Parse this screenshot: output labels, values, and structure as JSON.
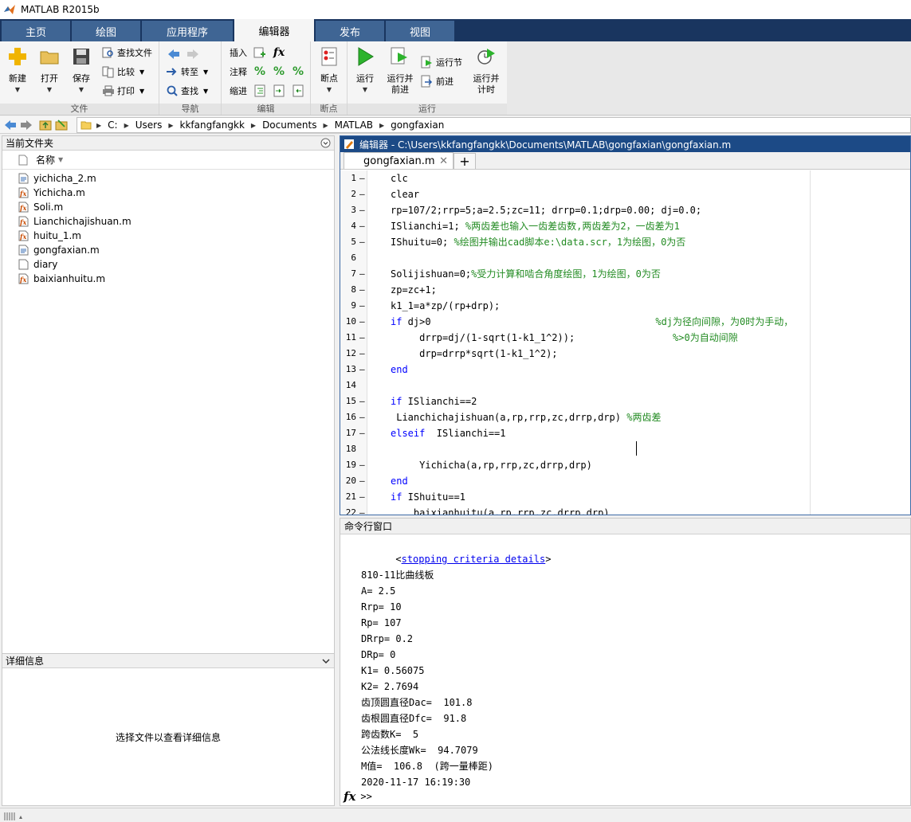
{
  "window": {
    "title": "MATLAB R2015b"
  },
  "tabs": [
    "主页",
    "绘图",
    "应用程序",
    "编辑器",
    "发布",
    "视图"
  ],
  "ribbon": {
    "file": {
      "new": "新建",
      "open": "打开",
      "save": "保存",
      "find_files": "查找文件",
      "compare": "比较",
      "print": "打印",
      "label": "文件"
    },
    "nav": {
      "goto": "转至",
      "find": "查找",
      "label": "导航"
    },
    "edit": {
      "insert": "插入",
      "comment": "注释",
      "indent": "缩进",
      "label": "编辑"
    },
    "breakpoints": {
      "btn": "断点",
      "label": "断点"
    },
    "run": {
      "run": "运行",
      "run_advance": "运行并\n前进",
      "run_section": "运行节",
      "advance": "前进",
      "run_time": "运行并\n计时",
      "label": "运行"
    }
  },
  "path": [
    "C:",
    "Users",
    "kkfangfangkk",
    "Documents",
    "MATLAB",
    "gongfaxian"
  ],
  "left_panel": {
    "title": "当前文件夹",
    "col_name": "名称",
    "files": [
      {
        "name": "yichicha_2.m",
        "icon": "mfile-icon"
      },
      {
        "name": "Yichicha.m",
        "icon": "function-file-icon"
      },
      {
        "name": "Soli.m",
        "icon": "function-file-icon"
      },
      {
        "name": "Lianchichajishuan.m",
        "icon": "function-file-icon"
      },
      {
        "name": "huitu_1.m",
        "icon": "function-file-icon"
      },
      {
        "name": "gongfaxian.m",
        "icon": "mfile-icon"
      },
      {
        "name": "diary",
        "icon": "blank-file-icon"
      },
      {
        "name": "baixianhuitu.m",
        "icon": "function-file-icon"
      }
    ],
    "details_title": "详细信息",
    "details_msg": "选择文件以查看详细信息"
  },
  "editor": {
    "title": "编辑器 - C:\\Users\\kkfangfangkk\\Documents\\MATLAB\\gongfaxian\\gongfaxian.m",
    "tab": "gongfaxian.m",
    "lines": [
      {
        "n": "1",
        "d": "–",
        "s": [
          [
            "",
            "clc"
          ]
        ]
      },
      {
        "n": "2",
        "d": "–",
        "s": [
          [
            "",
            "clear"
          ]
        ]
      },
      {
        "n": "3",
        "d": "–",
        "s": [
          [
            "",
            "rp=107/2;rrp=5;a=2.5;zc=11; drrp=0.1;drp=0.00; dj=0.0;"
          ]
        ]
      },
      {
        "n": "4",
        "d": "–",
        "s": [
          [
            "",
            "ISlianchi=1; "
          ],
          [
            "cm",
            "%两齿差也输入一齿差齿数,两齿差为2，一齿差为1"
          ]
        ]
      },
      {
        "n": "5",
        "d": "–",
        "s": [
          [
            "",
            "IShuitu=0; "
          ],
          [
            "cm",
            "%绘图并输出cad脚本e:\\data.scr，1为绘图，0为否"
          ]
        ]
      },
      {
        "n": "6",
        "d": "",
        "s": []
      },
      {
        "n": "7",
        "d": "–",
        "s": [
          [
            "",
            "Solijishuan=0;"
          ],
          [
            "cm",
            "%受力计算和啮合角度绘图，1为绘图，0为否"
          ]
        ]
      },
      {
        "n": "8",
        "d": "–",
        "s": [
          [
            "",
            "zp=zc+1;"
          ]
        ]
      },
      {
        "n": "9",
        "d": "–",
        "s": [
          [
            "",
            "k1_1=a*zp/(rp+drp);"
          ]
        ]
      },
      {
        "n": "10",
        "d": "–",
        "s": [
          [
            "kw",
            "if"
          ],
          [
            "",
            " dj>0                                       "
          ],
          [
            "cm",
            "%dj为径向间隙，为0时为手动，"
          ]
        ]
      },
      {
        "n": "11",
        "d": "–",
        "s": [
          [
            "",
            "     drrp=dj/(1-sqrt(1-k1_1^2));                 "
          ],
          [
            "cm",
            "%>0为自动间隙"
          ]
        ]
      },
      {
        "n": "12",
        "d": "–",
        "s": [
          [
            "",
            "     drp=drrp*sqrt(1-k1_1^2);"
          ]
        ]
      },
      {
        "n": "13",
        "d": "–",
        "s": [
          [
            "kw",
            "end"
          ]
        ]
      },
      {
        "n": "14",
        "d": "",
        "s": []
      },
      {
        "n": "15",
        "d": "–",
        "s": [
          [
            "kw",
            "if"
          ],
          [
            "",
            " ISlianchi==2"
          ]
        ]
      },
      {
        "n": "16",
        "d": "–",
        "s": [
          [
            "",
            " Lianchichajishuan(a,rp,rrp,zc,drrp,drp) "
          ],
          [
            "cm",
            "%两齿差"
          ]
        ]
      },
      {
        "n": "17",
        "d": "–",
        "s": [
          [
            "kw",
            "elseif"
          ],
          [
            "",
            "  ISlianchi==1"
          ]
        ]
      },
      {
        "n": "18",
        "d": "",
        "s": []
      },
      {
        "n": "19",
        "d": "–",
        "s": [
          [
            "",
            "     Yichicha(a,rp,rrp,zc,drrp,drp)"
          ]
        ]
      },
      {
        "n": "20",
        "d": "–",
        "s": [
          [
            "kw",
            "end"
          ]
        ]
      },
      {
        "n": "21",
        "d": "–",
        "s": [
          [
            "kw",
            "if"
          ],
          [
            "",
            " IShuitu==1"
          ]
        ]
      },
      {
        "n": "22",
        "d": "–",
        "s": [
          [
            "",
            "    baixianhuitu(a,rp,rrp,zc,drrp,drp)"
          ]
        ]
      }
    ]
  },
  "command_window": {
    "title": "命令行窗口",
    "link_pre": "<",
    "link": "stopping criteria details",
    "link_post": ">",
    "lines": [
      "",
      "810-11比曲线板",
      "A= 2.5",
      "Rrp= 10",
      "Rp= 107",
      "DRrp= 0.2",
      "DRp= 0",
      "K1= 0.56075",
      "K2= 2.7694",
      "齿顶圆直径Dac=  101.8",
      "齿根圆直径Dfc=  91.8",
      "跨齿数K=  5",
      "公法线长度Wk=  94.7079",
      "M值=  106.8  (跨一量棒距)",
      "2020-11-17 16:19:30"
    ],
    "prompt": ">>",
    "fx": "fx"
  },
  "colors": {
    "tab_bar": "#19355f",
    "tab": "#3f6594",
    "editor_title": "#1c4a86",
    "keyword": "#0000ff",
    "comment": "#228b22",
    "link": "#0000ee"
  }
}
